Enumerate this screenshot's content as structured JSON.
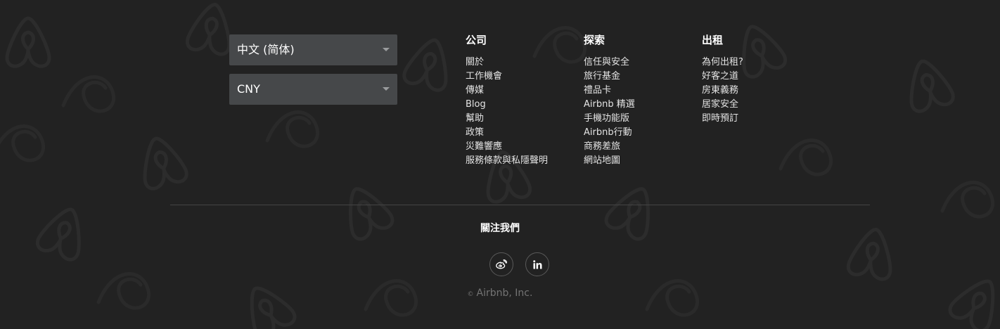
{
  "selectors": {
    "language": "中文 (简体)",
    "currency": "CNY"
  },
  "columns": {
    "company": {
      "title": "公司",
      "links": [
        "關於",
        "工作機會",
        "傳媒",
        "Blog",
        "幫助",
        "政策",
        "災難響應",
        "服務條款與私隱聲明"
      ]
    },
    "explore": {
      "title": "探索",
      "links": [
        "信任與安全",
        "旅行基金",
        "禮品卡",
        "Airbnb 精選",
        "手機功能版",
        "Airbnb行動",
        "商務差旅",
        "網站地圖"
      ]
    },
    "host": {
      "title": "出租",
      "links": [
        "為何出租?",
        "好客之道",
        "房東義務",
        "居家安全",
        "即時預訂"
      ]
    }
  },
  "follow": {
    "title": "關注我們",
    "icons": [
      "weibo-icon",
      "linkedin-icon"
    ]
  },
  "copyright": {
    "symbol": "©",
    "text": "Airbnb, Inc."
  },
  "colors": {
    "background": "#222222",
    "select_bg": "#46484a",
    "link_text": "#e4e4e4",
    "muted_text": "#737373",
    "divider": "#444444"
  }
}
